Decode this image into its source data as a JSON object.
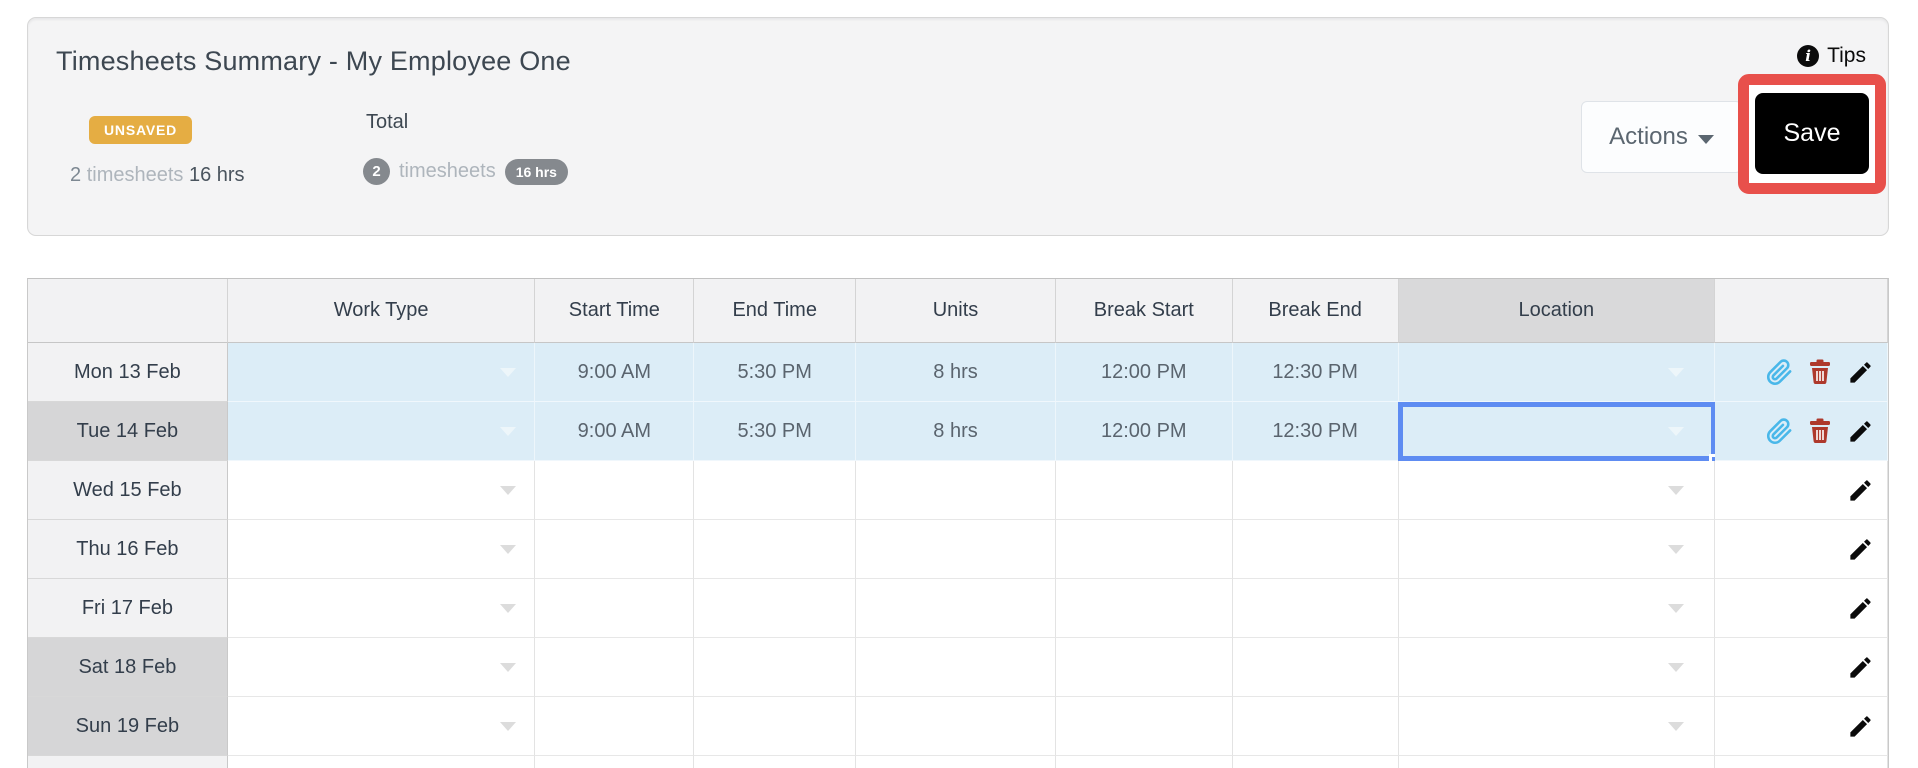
{
  "panel": {
    "title": "Timesheets Summary - My Employee One",
    "status_badge": "UNSAVED",
    "unsaved_summary": {
      "count": "2",
      "unit": "timesheets",
      "hours": "16 hrs"
    },
    "total": {
      "label": "Total",
      "count": "2",
      "unit": "timesheets",
      "hours": "16 hrs"
    },
    "tips_label": "Tips",
    "actions_label": "Actions",
    "save_label": "Save"
  },
  "table": {
    "columns": {
      "day": "",
      "work_type": "Work Type",
      "start_time": "Start Time",
      "end_time": "End Time",
      "units": "Units",
      "break_start": "Break Start",
      "break_end": "Break End",
      "location": "Location",
      "actions": ""
    },
    "rows": [
      {
        "day": "Mon 13 Feb",
        "work_type": "",
        "start_time": "9:00 AM",
        "end_time": "5:30 PM",
        "units": "8 hrs",
        "break_start": "12:00 PM",
        "break_end": "12:30 PM",
        "location": ""
      },
      {
        "day": "Tue 14 Feb",
        "work_type": "",
        "start_time": "9:00 AM",
        "end_time": "5:30 PM",
        "units": "8 hrs",
        "break_start": "12:00 PM",
        "break_end": "12:30 PM",
        "location": ""
      },
      {
        "day": "Wed 15 Feb",
        "work_type": "",
        "start_time": "",
        "end_time": "",
        "units": "",
        "break_start": "",
        "break_end": "",
        "location": ""
      },
      {
        "day": "Thu 16 Feb",
        "work_type": "",
        "start_time": "",
        "end_time": "",
        "units": "",
        "break_start": "",
        "break_end": "",
        "location": ""
      },
      {
        "day": "Fri 17 Feb",
        "work_type": "",
        "start_time": "",
        "end_time": "",
        "units": "",
        "break_start": "",
        "break_end": "",
        "location": ""
      },
      {
        "day": "Sat 18 Feb",
        "work_type": "",
        "start_time": "",
        "end_time": "",
        "units": "",
        "break_start": "",
        "break_end": "",
        "location": ""
      },
      {
        "day": "Sun 19 Feb",
        "work_type": "",
        "start_time": "",
        "end_time": "",
        "units": "",
        "break_start": "",
        "break_end": "",
        "location": ""
      }
    ],
    "selected_cell": {
      "row": "Tue 14 Feb",
      "column": "Location"
    }
  },
  "icons": {
    "info": "info-icon",
    "caret_down": "caret-down-icon",
    "dropdown_arrow": "dropdown-arrow-icon",
    "paperclip": "paperclip-icon",
    "trash": "trash-icon",
    "pencil": "pencil-icon"
  },
  "colors": {
    "unsaved_badge": "#e5ad43",
    "count_badge": "#85898e",
    "row_highlight": "#dcedf7",
    "selection_blue": "#5e8cf2",
    "annotation_red": "#e8504b",
    "location_header": "#d9d9da",
    "paperclip_blue": "#49b7e9",
    "trash_red": "#ae392c",
    "save_button_bg": "#000000"
  }
}
